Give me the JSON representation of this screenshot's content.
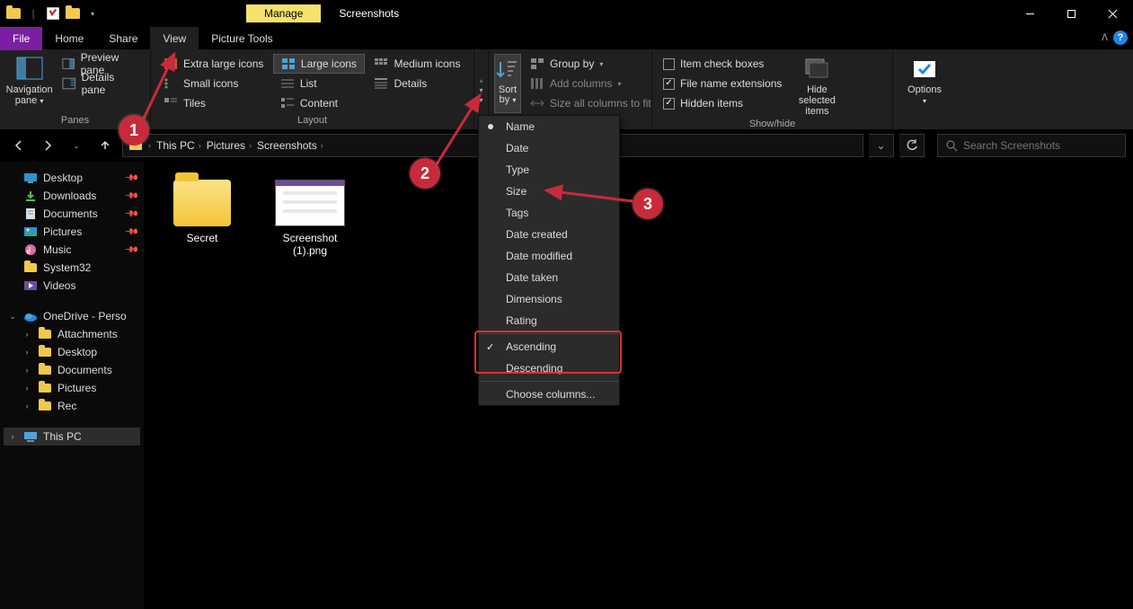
{
  "window": {
    "manage_tab": "Manage",
    "title": "Screenshots"
  },
  "menu": {
    "file": "File",
    "home": "Home",
    "share": "Share",
    "view": "View",
    "picture_tools": "Picture Tools"
  },
  "ribbon": {
    "panes": {
      "navigation_pane": "Navigation pane",
      "preview_pane": "Preview pane",
      "details_pane": "Details pane",
      "group_label": "Panes"
    },
    "layout": {
      "extra_large": "Extra large icons",
      "large": "Large icons",
      "medium": "Medium icons",
      "small": "Small icons",
      "list": "List",
      "details": "Details",
      "tiles": "Tiles",
      "content": "Content",
      "group_label": "Layout"
    },
    "current_view": {
      "sort_by": "Sort by",
      "group_by": "Group by",
      "add_columns": "Add columns",
      "size_all": "Size all columns to fit"
    },
    "show_hide": {
      "item_check_boxes": "Item check boxes",
      "file_ext": "File name extensions",
      "hidden_items": "Hidden items",
      "hide_selected": "Hide selected items",
      "group_label": "Show/hide"
    },
    "options": "Options"
  },
  "breadcrumb": {
    "this_pc": "This PC",
    "pictures": "Pictures",
    "screenshots": "Screenshots"
  },
  "search": {
    "placeholder": "Search Screenshots"
  },
  "tree": {
    "desktop": "Desktop",
    "downloads": "Downloads",
    "documents": "Documents",
    "pictures": "Pictures",
    "music": "Music",
    "system32": "System32",
    "videos": "Videos",
    "onedrive": "OneDrive - Perso",
    "attachments": "Attachments",
    "od_desktop": "Desktop",
    "od_documents": "Documents",
    "od_pictures": "Pictures",
    "rec": "Rec",
    "this_pc": "This PC"
  },
  "files": {
    "secret": "Secret",
    "screenshot1": "Screenshot (1).png"
  },
  "sort_menu": {
    "name": "Name",
    "date": "Date",
    "type": "Type",
    "size": "Size",
    "tags": "Tags",
    "date_created": "Date created",
    "date_modified": "Date modified",
    "date_taken": "Date taken",
    "dimensions": "Dimensions",
    "rating": "Rating",
    "ascending": "Ascending",
    "descending": "Descending",
    "choose_columns": "Choose columns..."
  },
  "annotations": {
    "n1": "1",
    "n2": "2",
    "n3": "3"
  }
}
